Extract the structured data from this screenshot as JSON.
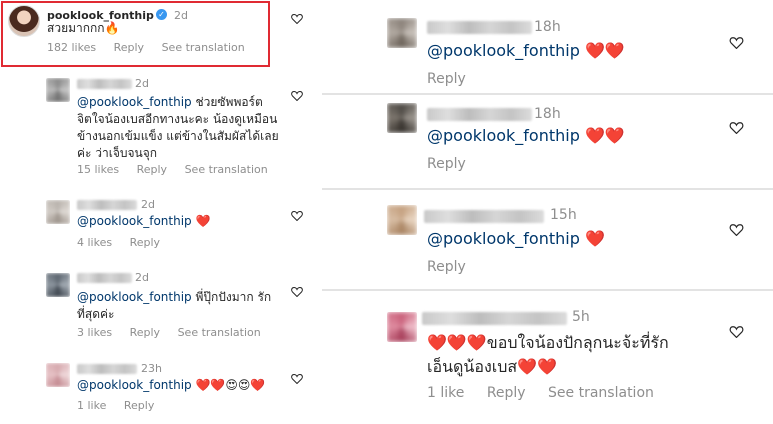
{
  "colors": {
    "mention": "#00376b",
    "heart": "#ed1c24",
    "muted": "#8e8e8e",
    "highlight": "#e02a33",
    "verified": "#3897f0"
  },
  "left": {
    "top_comment": {
      "username": "pooklook_fonthip",
      "time": "2d",
      "text": "สวยมากกก",
      "emoji": "🔥",
      "likes": "182 likes",
      "reply": "Reply",
      "see_translation": "See translation"
    },
    "comments": [
      {
        "time": "2d",
        "mention": "@pooklook_fonthip",
        "text_lines": [
          " ช่วยซัพพอร์ต",
          "จิตใจน้องเบสอีกทางนะคะ น้องดูเหมือน",
          "ข้างนอกเข้มแข็ง แต่ข้างในสัมผัสได้เลย",
          "ค่ะ ว่าเจ็บจนจุก"
        ],
        "likes": "15 likes",
        "reply": "Reply",
        "see_translation": "See translation"
      },
      {
        "time": "2d",
        "mention": "@pooklook_fonthip",
        "emoji": "❤️",
        "likes": "4 likes",
        "reply": "Reply"
      },
      {
        "time": "2d",
        "mention": "@pooklook_fonthip",
        "text_lines": [
          " พี่ปุ๊กปังมาก รัก",
          "ที่สุดค่ะ"
        ],
        "likes": "3 likes",
        "reply": "Reply",
        "see_translation": "See translation"
      },
      {
        "time": "23h",
        "mention": "@pooklook_fonthip",
        "emoji": "❤️❤️😍😍❤️",
        "likes": "1 like",
        "reply": "Reply"
      }
    ]
  },
  "right": {
    "comments": [
      {
        "time": "18h",
        "mention": "@pooklook_fonthip",
        "emoji": "❤️❤️",
        "reply": "Reply"
      },
      {
        "time": "18h",
        "mention": "@pooklook_fonthip",
        "emoji": "❤️❤️",
        "reply": "Reply"
      },
      {
        "time": "15h",
        "mention": "@pooklook_fonthip",
        "emoji": "❤️",
        "reply": "Reply"
      },
      {
        "time": "5h",
        "line1_emoji": "❤️❤️❤️",
        "line1_text": "ขอบใจน้องปักลุกนะจ้ะที่รัก",
        "line2_text": "เอ็นดูน้องเบส",
        "line2_emoji": "❤️❤️",
        "likes": "1 like",
        "reply": "Reply",
        "see_translation": "See translation"
      }
    ]
  },
  "icons": {
    "like": "heart-outline-icon",
    "verified": "verified-badge-icon",
    "fire": "fire-emoji"
  }
}
